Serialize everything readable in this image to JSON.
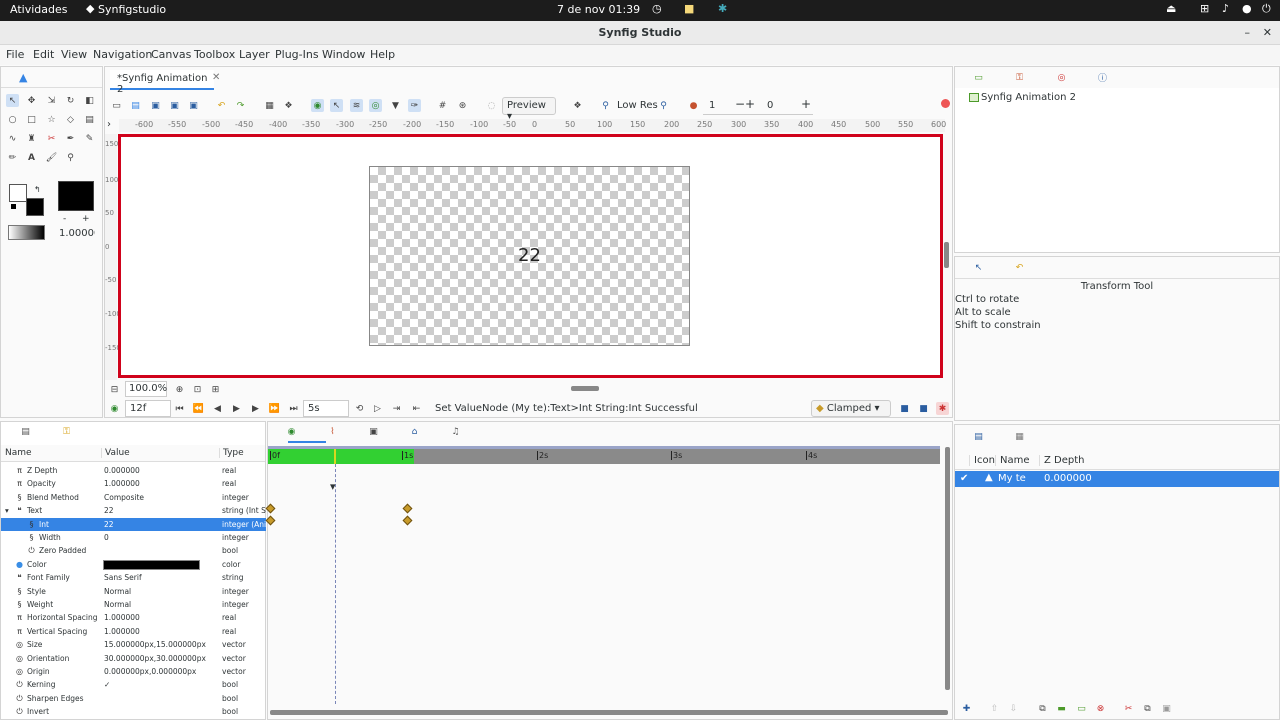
{
  "system": {
    "activities": "Atividades",
    "app": "Synfigstudio",
    "clock": "7 de nov  01:39"
  },
  "window": {
    "title": "Synfig Studio"
  },
  "menu": [
    "File",
    "Edit",
    "View",
    "Navigation",
    "Canvas",
    "Toolbox",
    "Layer",
    "Plug-Ins",
    "Window",
    "Help"
  ],
  "doc_tab": "*Synfig Animation 2",
  "toolbar": {
    "preview": "Preview",
    "quality": "Low Res",
    "spin1": "1",
    "spin2": "0"
  },
  "toolbox": {
    "opacity": "1.00000"
  },
  "canvas": {
    "text": "22",
    "zoom": "100.0%",
    "ruler_h": [
      "-600",
      "-550",
      "-500",
      "-450",
      "-400",
      "-350",
      "-300",
      "-250",
      "-200",
      "-150",
      "-100",
      "-50",
      "0",
      "50",
      "100",
      "150",
      "200",
      "250",
      "300",
      "350",
      "400",
      "450",
      "500",
      "550",
      "600"
    ],
    "ruler_v": [
      "150",
      "100",
      "50",
      "0",
      "-50",
      "-100",
      "-150"
    ]
  },
  "timebar": {
    "frame": "12f",
    "end": "5s",
    "status": "Set ValueNode (My te):Text>Int String:Int Successful",
    "interp": "Clamped"
  },
  "params": {
    "headers": {
      "name": "Name",
      "value": "Value",
      "type": "Type"
    },
    "rows": [
      {
        "icon": "π",
        "name": "Z Depth",
        "value": "0.000000",
        "type": "real"
      },
      {
        "icon": "π",
        "name": "Opacity",
        "value": "1.000000",
        "type": "real"
      },
      {
        "icon": "§",
        "name": "Blend Method",
        "value": "Composite",
        "type": "integer"
      },
      {
        "icon": "❝",
        "name": "Text",
        "value": "22",
        "type": "string (Int Stri",
        "expanded": true
      },
      {
        "icon": "§",
        "name": "Int",
        "value": "22",
        "type": "integer (Anim",
        "selected": true,
        "indent": 1
      },
      {
        "icon": "§",
        "name": "Width",
        "value": "0",
        "type": "integer",
        "indent": 1
      },
      {
        "icon": "⏻",
        "name": "Zero Padded",
        "value": "",
        "type": "bool",
        "indent": 1
      },
      {
        "icon": "●",
        "name": "Color",
        "value": "",
        "type": "color",
        "swatch": "#000000"
      },
      {
        "icon": "❝",
        "name": "Font Family",
        "value": "Sans Serif",
        "type": "string"
      },
      {
        "icon": "§",
        "name": "Style",
        "value": "Normal",
        "type": "integer"
      },
      {
        "icon": "§",
        "name": "Weight",
        "value": "Normal",
        "type": "integer"
      },
      {
        "icon": "π",
        "name": "Horizontal Spacing",
        "value": "1.000000",
        "type": "real"
      },
      {
        "icon": "π",
        "name": "Vertical Spacing",
        "value": "1.000000",
        "type": "real"
      },
      {
        "icon": "◎",
        "name": "Size",
        "value": "15.000000px,15.000000px",
        "type": "vector"
      },
      {
        "icon": "◎",
        "name": "Orientation",
        "value": "30.000000px,30.000000px",
        "type": "vector"
      },
      {
        "icon": "◎",
        "name": "Origin",
        "value": "0.000000px,0.000000px",
        "type": "vector"
      },
      {
        "icon": "⏻",
        "name": "Kerning",
        "value": "✓",
        "type": "bool"
      },
      {
        "icon": "⏻",
        "name": "Sharpen Edges",
        "value": "",
        "type": "bool"
      },
      {
        "icon": "⏻",
        "name": "Invert",
        "value": "",
        "type": "bool"
      }
    ]
  },
  "timetrack": {
    "marks": [
      "0f",
      "1s",
      "2s",
      "3s",
      "4s"
    ]
  },
  "canvas_browser": {
    "item": "Synfig Animation 2"
  },
  "tool_options": {
    "title": "Transform Tool",
    "lines": [
      "Ctrl to rotate",
      "Alt to scale",
      "Shift to constrain"
    ]
  },
  "layers": {
    "headers": {
      "icon": "Icon",
      "name": "Name",
      "zdepth": "Z Depth"
    },
    "rows": [
      {
        "name": "My te",
        "zdepth": "0.000000"
      }
    ]
  }
}
